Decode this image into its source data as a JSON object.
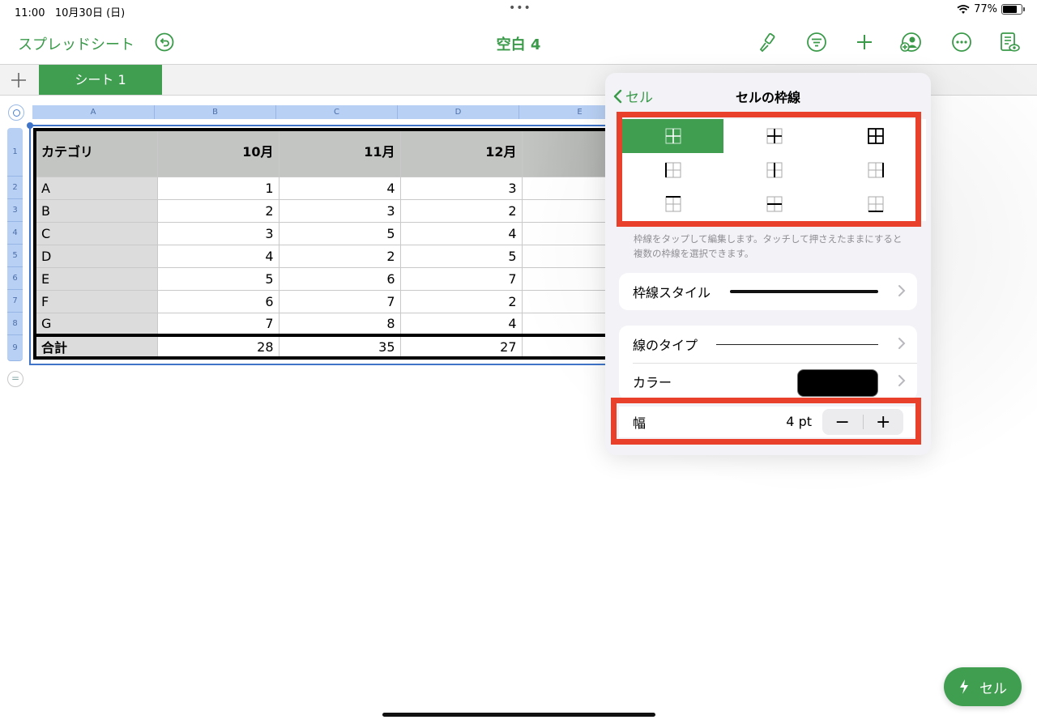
{
  "status": {
    "time": "11:00",
    "date": "10月30日 (日)",
    "dots": "•••",
    "battery": "77%",
    "battery_level": 0.77
  },
  "toolbar": {
    "back_label": "スプレッドシート",
    "title": "空白 4"
  },
  "tabs": {
    "active": "シート 1"
  },
  "columns": [
    "A",
    "B",
    "C",
    "D",
    "E"
  ],
  "rows": [
    "1",
    "2",
    "3",
    "4",
    "5",
    "6",
    "7",
    "8",
    "9"
  ],
  "table": {
    "header": [
      "カテゴリ",
      "10月",
      "11月",
      "12月",
      ""
    ],
    "body": [
      [
        "A",
        "1",
        "4",
        "3"
      ],
      [
        "B",
        "2",
        "3",
        "2"
      ],
      [
        "C",
        "3",
        "5",
        "4"
      ],
      [
        "D",
        "4",
        "2",
        "5"
      ],
      [
        "E",
        "5",
        "6",
        "7"
      ],
      [
        "F",
        "6",
        "7",
        "2"
      ],
      [
        "G",
        "7",
        "8",
        "4"
      ]
    ],
    "total": [
      "合計",
      "28",
      "35",
      "27"
    ]
  },
  "popover": {
    "back": "セル",
    "title": "セルの枠線",
    "hint": "枠線をタップして編集します。タッチして押さえたままにすると複数の枠線を選択できます。",
    "border_style_label": "枠線スタイル",
    "line_type_label": "線のタイプ",
    "color_label": "カラー",
    "color_value": "#000000",
    "width_label": "幅",
    "width_value": "4 pt",
    "minus": "−",
    "plus": "+"
  },
  "fab": {
    "label": "セル"
  },
  "colors": {
    "accent": "#3f9e50",
    "highlight": "#e8402a",
    "selection": "#3f74c9"
  }
}
